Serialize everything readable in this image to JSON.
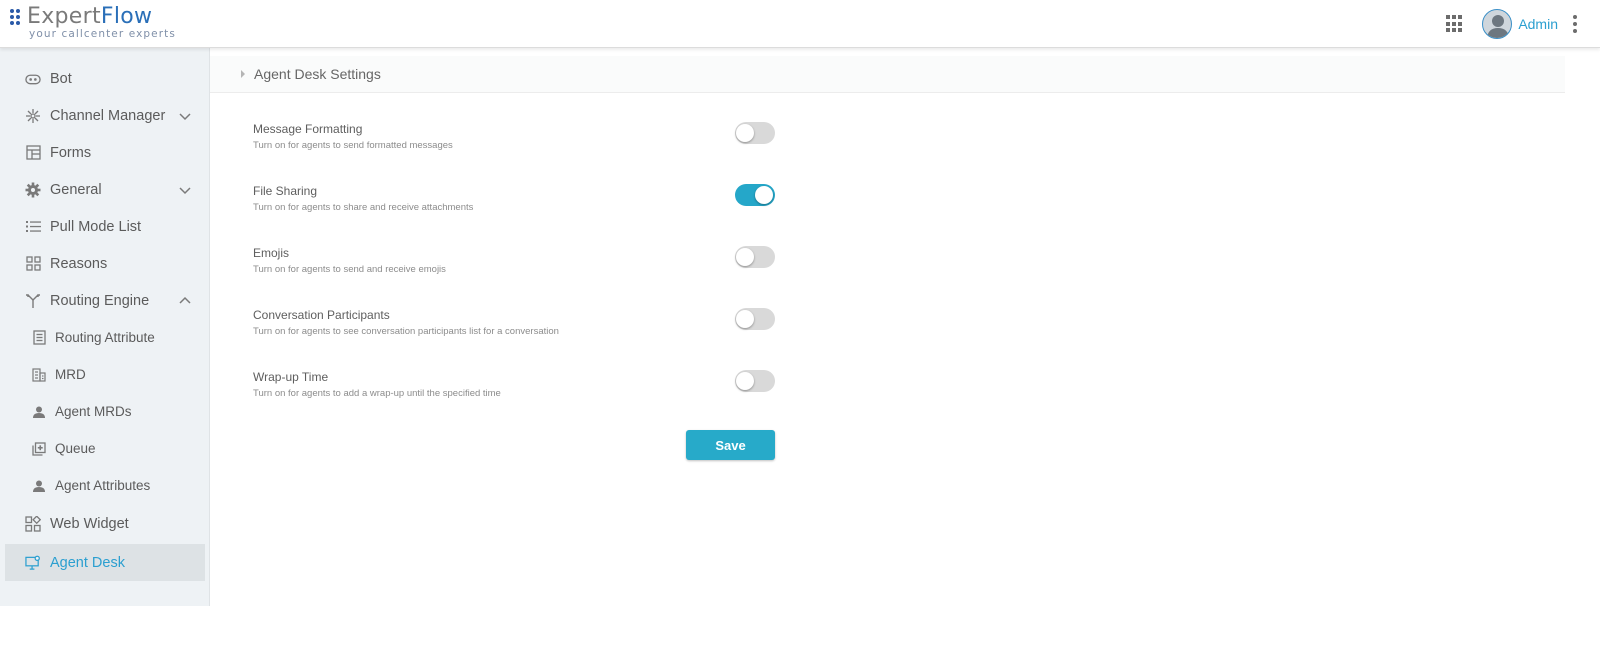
{
  "header": {
    "logo_main": "Expert",
    "logo_accent": "Flow",
    "logo_tagline": "your callcenter experts",
    "user_name": "Admin"
  },
  "sidebar": {
    "items": [
      {
        "label": "Bot",
        "icon": "bot-icon"
      },
      {
        "label": "Channel Manager",
        "icon": "channel-manager-icon",
        "chevron": "down"
      },
      {
        "label": "Forms",
        "icon": "forms-icon"
      },
      {
        "label": "General",
        "icon": "gear-icon",
        "chevron": "down"
      },
      {
        "label": "Pull Mode List",
        "icon": "list-icon"
      },
      {
        "label": "Reasons",
        "icon": "grid-icon"
      },
      {
        "label": "Routing Engine",
        "icon": "routing-icon",
        "chevron": "up"
      },
      {
        "label": "Routing Attribute",
        "icon": "document-icon",
        "sub": true
      },
      {
        "label": "MRD",
        "icon": "building-icon",
        "sub": true
      },
      {
        "label": "Agent MRDs",
        "icon": "users-icon",
        "sub": true
      },
      {
        "label": "Queue",
        "icon": "queue-icon",
        "sub": true
      },
      {
        "label": "Agent Attributes",
        "icon": "users-icon",
        "sub": true
      },
      {
        "label": "Web Widget",
        "icon": "widget-icon"
      },
      {
        "label": "Agent Desk",
        "icon": "monitor-icon",
        "active": true
      }
    ]
  },
  "main": {
    "section_title": "Agent Desk Settings",
    "settings": [
      {
        "title": "Message Formatting",
        "description": "Turn on for agents to send formatted messages",
        "enabled": false
      },
      {
        "title": "File Sharing",
        "description": "Turn on for agents to share and receive attachments",
        "enabled": true
      },
      {
        "title": "Emojis",
        "description": "Turn on for agents to send and receive emojis",
        "enabled": false
      },
      {
        "title": "Conversation Participants",
        "description": "Turn on for agents to see conversation participants list for a conversation",
        "enabled": false
      },
      {
        "title": "Wrap-up Time",
        "description": "Turn on for agents to add a wrap-up until the specified time",
        "enabled": false
      }
    ],
    "save_label": "Save"
  },
  "colors": {
    "accent": "#25a7c9",
    "brand_blue": "#2a6fb8",
    "sidebar_bg": "#eef2f5",
    "active_item_bg": "#dde2e5"
  }
}
